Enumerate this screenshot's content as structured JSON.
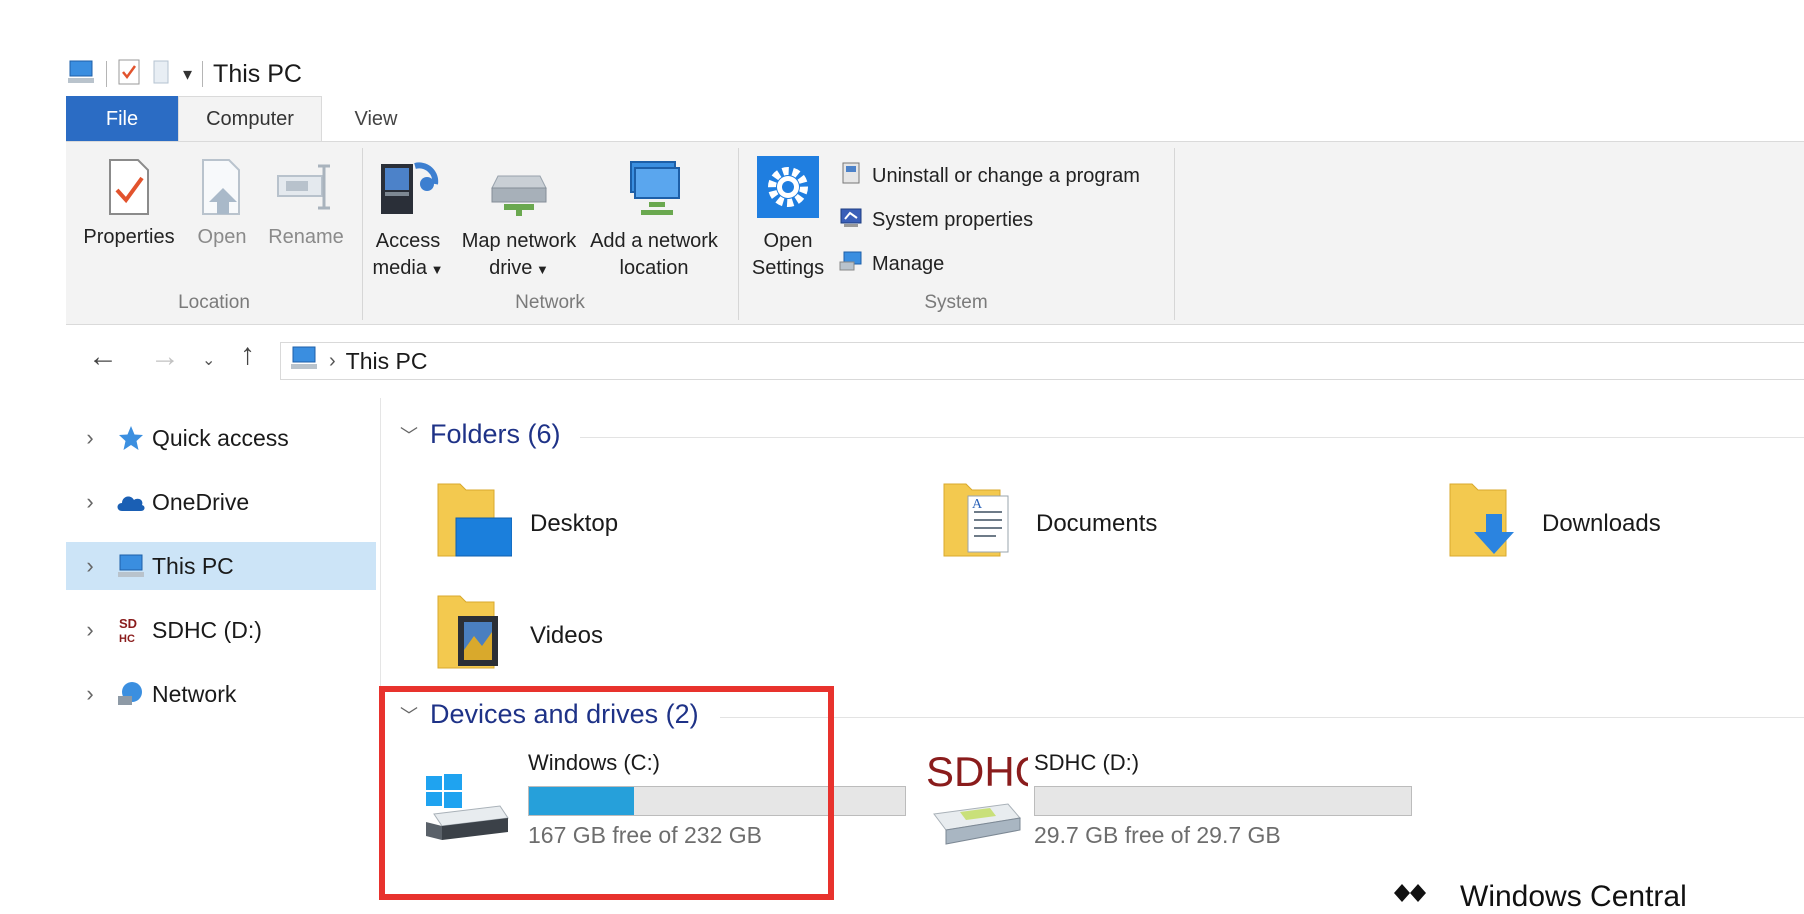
{
  "window": {
    "title": "This PC"
  },
  "ribbon": {
    "tabs": {
      "file": "File",
      "computer": "Computer",
      "view": "View"
    },
    "location": {
      "label": "Location",
      "properties": "Properties",
      "open": "Open",
      "rename": "Rename"
    },
    "network": {
      "label": "Network",
      "access_media_1": "Access",
      "access_media_2": "media",
      "map_drive_1": "Map network",
      "map_drive_2": "drive",
      "add_location_1": "Add a network",
      "add_location_2": "location"
    },
    "system": {
      "label": "System",
      "open_settings_1": "Open",
      "open_settings_2": "Settings",
      "uninstall": "Uninstall or change a program",
      "system_properties": "System properties",
      "manage": "Manage"
    }
  },
  "address": {
    "path": "This PC"
  },
  "nav": {
    "items": [
      {
        "label": "Quick access"
      },
      {
        "label": "OneDrive"
      },
      {
        "label": "This PC"
      },
      {
        "label": "SDHC (D:)"
      },
      {
        "label": "Network"
      }
    ]
  },
  "folders": {
    "header": "Folders (6)",
    "items": [
      {
        "label": "Desktop"
      },
      {
        "label": "Documents"
      },
      {
        "label": "Downloads"
      },
      {
        "label": "Videos"
      }
    ]
  },
  "drives": {
    "header": "Devices and drives (2)",
    "items": [
      {
        "name": "Windows (C:)",
        "free_text": "167 GB free of 232 GB",
        "used_fraction": 0.28,
        "logo": ""
      },
      {
        "name": "SDHC (D:)",
        "free_text": "29.7 GB free of 29.7 GB",
        "used_fraction": 0.0,
        "logo": "SDHC"
      }
    ]
  },
  "watermark": {
    "text": "Windows Central"
  },
  "colors": {
    "accent": "#2b6cc4",
    "selection": "#cce4f7",
    "highlight": "#e8322d",
    "header_text": "#1e3287"
  }
}
